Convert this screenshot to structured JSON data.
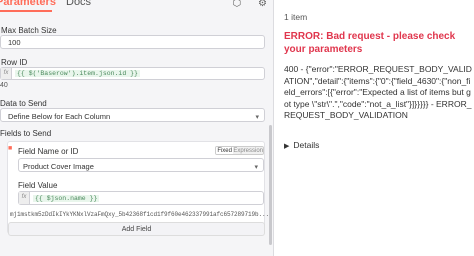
{
  "tabs": {
    "parameters": "Parameters",
    "docs": "Docs"
  },
  "fields": {
    "max_batch_label": "Max Batch Size",
    "max_batch_value": "100",
    "row_id_label": "Row ID",
    "row_id_fx": "fx",
    "row_id_expr": "{{ $('Baserow').item.json.id }}",
    "row_id_preview": "40",
    "data_to_send_label": "Data to Send",
    "data_to_send_value": "Define Below for Each Column",
    "fields_to_send_label": "Fields to Send",
    "field_name_label": "Field Name or ID",
    "toggle_fixed": "Fixed",
    "toggle_expression": "Expression",
    "field_name_value": "Product Cover Image",
    "field_value_label": "Field Value",
    "field_value_fx": "fx",
    "field_value_expr": "{{ $json.name }}",
    "field_value_preview": "mj1mstkm5zDdIkIYkYKNxlVzaFmQxy_5b42368f1cd1f9f60e462337991afc657289719b...",
    "add_field_label": "Add Field"
  },
  "output": {
    "items_count": "1 item",
    "error_title": "ERROR: Bad request - please check your parameters",
    "error_body": "400 - {\"error\":\"ERROR_REQUEST_BODY_VALIDATION\",\"detail\":{\"items\":{\"0\":{\"field_4630\":{\"non_field_errors\":[{\"error\":\"Expected a list of items but got type \\\"str\\\".\",\"code\":\"not_a_list\"}]}}}}} - ERROR_REQUEST_BODY_VALIDATION",
    "details_label": "Details"
  },
  "colors": {
    "accent": "#ff6d5a",
    "error": "#e0364d",
    "expression": "#4a8a5c"
  },
  "icons": [
    "cube-icon",
    "gear-icon",
    "trash-icon",
    "chevron-down-icon",
    "chevron-right-icon"
  ]
}
